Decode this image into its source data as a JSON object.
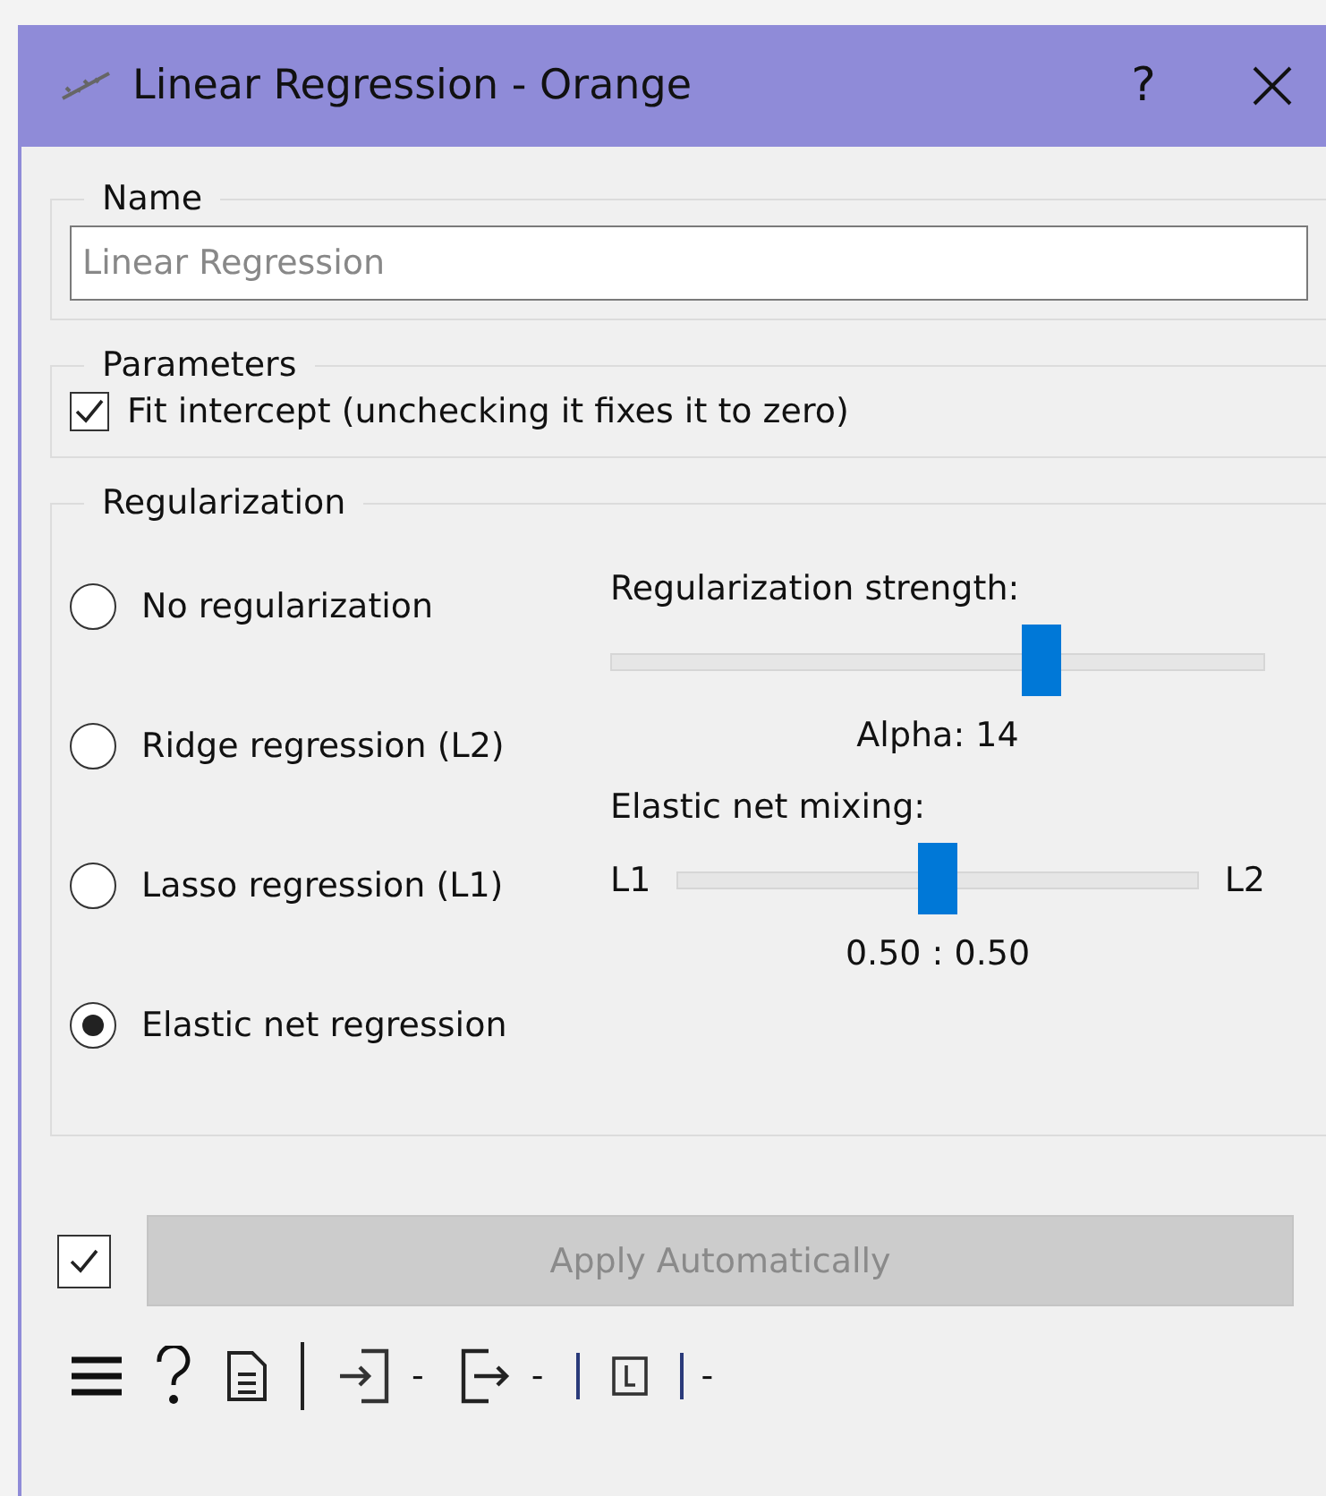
{
  "window": {
    "title": "Linear Regression - Orange",
    "help": "?"
  },
  "name_box": {
    "title": "Name",
    "placeholder": "Linear Regression"
  },
  "parameters": {
    "title": "Parameters",
    "fit_intercept": {
      "label": "Fit intercept (unchecking it fixes it to zero)",
      "checked": true
    }
  },
  "regularization": {
    "title": "Regularization",
    "options": [
      {
        "label": "No regularization",
        "selected": false
      },
      {
        "label": "Ridge regression (L2)",
        "selected": false
      },
      {
        "label": "Lasso regression (L1)",
        "selected": false
      },
      {
        "label": "Elastic net regression",
        "selected": true
      }
    ],
    "strength": {
      "label": "Regularization strength:",
      "level": 0.66,
      "reading": "Alpha: 14"
    },
    "mixing": {
      "label": "Elastic net mixing:",
      "left": "L1",
      "right": "L2",
      "level": 0.5,
      "reading": "0.50 : 0.50"
    }
  },
  "apply": {
    "checked": true,
    "label": "Apply Automatically",
    "disabled": true
  },
  "status_bar": {
    "input_count": "-",
    "output_count": "-",
    "warnings": "-"
  }
}
